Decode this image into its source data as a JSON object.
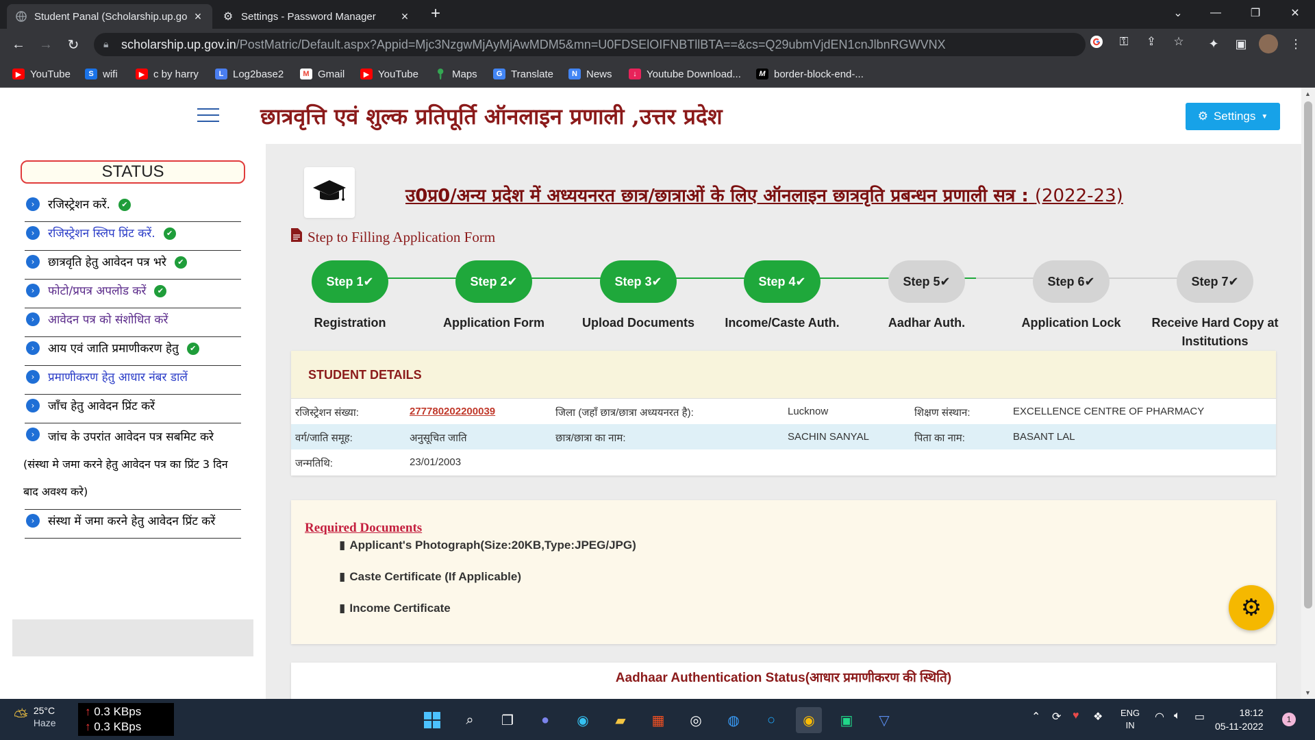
{
  "browser": {
    "tabs": [
      {
        "title": "Student Panal (Scholarship.up.go",
        "active": true
      },
      {
        "title": "Settings - Password Manager",
        "active": false
      }
    ],
    "url_host": "scholarship.up.gov.in",
    "url_path": "/PostMatric/Default.aspx?Appid=Mjc3NzgwMjAyMjAwMDM5&mn=U0FDSElOIFNBTllBTA==&cs=Q29ubmVjdEN1cnJlbnRGWVNX",
    "bookmarks": [
      {
        "label": "YouTube",
        "icon": "youtube-icon",
        "color": "#ff0000"
      },
      {
        "label": "wifi",
        "icon": "s-icon",
        "color": "#1a73e8"
      },
      {
        "label": "c by harry",
        "icon": "youtube-icon",
        "color": "#ff0000"
      },
      {
        "label": "Log2base2",
        "icon": "l-icon",
        "color": "#4a7ef0"
      },
      {
        "label": "Gmail",
        "icon": "gmail-icon",
        "color": "#ea4335"
      },
      {
        "label": "YouTube",
        "icon": "youtube-icon",
        "color": "#ff0000"
      },
      {
        "label": "Maps",
        "icon": "maps-icon",
        "color": "#34a853"
      },
      {
        "label": "Translate",
        "icon": "translate-icon",
        "color": "#4285f4"
      },
      {
        "label": "News",
        "icon": "news-icon",
        "color": "#4285f4"
      },
      {
        "label": "Youtube Download...",
        "icon": "download-icon",
        "color": "#e8235a"
      },
      {
        "label": "border-block-end-...",
        "icon": "mdn-icon",
        "color": "#000000"
      }
    ]
  },
  "header": {
    "site_title": "छात्रवृत्ति एवं शुल्क प्रतिपूर्ति ऑनलाइन प्रणाली ,उत्तर प्रदेश",
    "settings_label": "Settings"
  },
  "sidebar": {
    "status_label": "STATUS",
    "items": [
      {
        "text": "रजिस्ट्रेशन करें.",
        "done": true,
        "link": false
      },
      {
        "text": "रजिस्ट्रेशन स्लिप प्रिंट करें.",
        "done": true,
        "link": true
      },
      {
        "text": "छात्रवृति हेतु आवेदन पत्र भरे",
        "done": true,
        "link": false
      },
      {
        "text": "फोटो/प्रपत्र अपलोड करें",
        "done": true,
        "link": true
      },
      {
        "text": "आवेदन पत्र को संशोधित करें",
        "done": false,
        "link": true
      },
      {
        "text": "आय एवं जाति प्रमाणीकरण हेतु",
        "done": true,
        "link": false
      },
      {
        "text": "प्रमाणीकरण हेतु आधार नंबर डालें",
        "done": false,
        "link": true
      },
      {
        "text": "जाँच हेतु आवेदन प्रिंट करें",
        "done": false,
        "link": false
      },
      {
        "text": "जांच के उपरांत आवेदन पत्र सबमिट करे",
        "done": false,
        "link": false
      },
      {
        "text": "(संस्था मे जमा करने हेतु आवेदन पत्र का प्रिंट 3 दिन बाद अवश्य करे)",
        "done": false,
        "link": false
      },
      {
        "text": "संस्था में जमा करने हेतु आवेदन प्रिंट करें",
        "done": false,
        "link": false
      }
    ]
  },
  "main": {
    "title": "उ0प्र0/अन्य प्रदेश में अध्ययनरत छात्र/छात्राओं के लिए ऑनलाइन छात्रवृति प्रबन्धन प्रणाली सत्र :",
    "session": "(2022-23)",
    "step_heading": "Step to Filling Application Form",
    "steps": [
      {
        "pill": "Step 1",
        "label": "Registration",
        "done": true
      },
      {
        "pill": "Step 2",
        "label": "Application Form",
        "done": true
      },
      {
        "pill": "Step 3",
        "label": "Upload Documents",
        "done": true
      },
      {
        "pill": "Step 4",
        "label": "Income/Caste Auth.",
        "done": true
      },
      {
        "pill": "Step 5",
        "label": "Aadhar Auth.",
        "done": false
      },
      {
        "pill": "Step 6",
        "label": "Application Lock",
        "done": false
      },
      {
        "pill": "Step 7",
        "label": "Receive Hard Copy at Institutions",
        "done": false
      }
    ],
    "student_details": {
      "heading": "STUDENT DETAILS",
      "reg_label": "रजिस्ट्रेशन संख्या:",
      "reg_value": "277780202200039",
      "district_label": "जिला (जहाँ छात्र/छात्रा अध्ययनरत है):",
      "district_value": "Lucknow",
      "institute_label": "शिक्षण संस्थान:",
      "institute_value": "EXCELLENCE CENTRE OF PHARMACY",
      "caste_label": "वर्ग/जाति समूह:",
      "caste_value": "अनुसूचित जाति",
      "name_label": "छात्र/छात्रा का नाम:",
      "name_value": "SACHIN SANYAL",
      "father_label": "पिता का नाम:",
      "father_value": "BASANT LAL",
      "dob_label": "जन्मतिथि:",
      "dob_value": "23/01/2003"
    },
    "required_documents": {
      "heading": "Required Documents",
      "items": [
        "Applicant's Photograph(Size:20KB,Type:JPEG/JPG)",
        "Caste Certificate (If Applicable)",
        "Income Certificate"
      ]
    },
    "aadhaar_status": "Aadhaar Authentication Status(आधार प्रमाणीकरण की स्थिति)"
  },
  "taskbar": {
    "temperature": "25°C",
    "weather": "Haze",
    "upload_speed": "0.3 KBps",
    "download_speed": "0.3 KBps",
    "language": "ENG",
    "region": "IN",
    "time": "18:12",
    "date": "05-11-2022",
    "notifications": "1"
  },
  "colors": {
    "done": "#1fa83b",
    "todo": "#d4d4d4",
    "title_red": "#8b1a1a",
    "settings_blue": "#17a2e8"
  }
}
